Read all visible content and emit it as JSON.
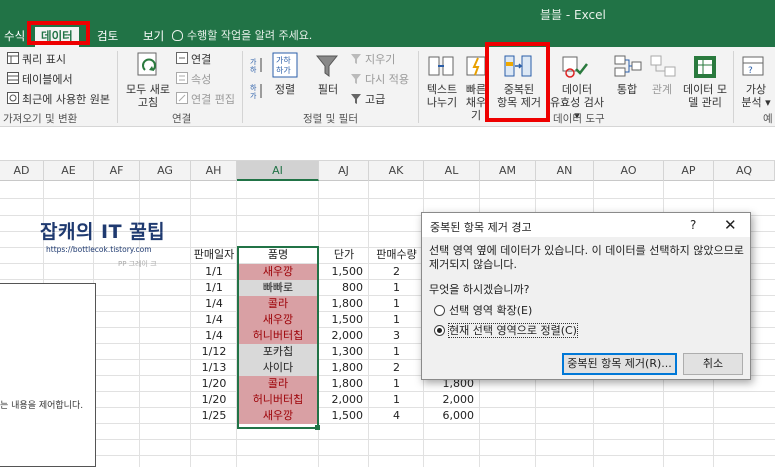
{
  "window": {
    "title": "블블 - Excel"
  },
  "tabs": [
    {
      "label": "수식"
    },
    {
      "label": "데이터"
    },
    {
      "label": "검토"
    },
    {
      "label": "보기"
    }
  ],
  "tell_me": "수행할 작업을 알려 주세요.",
  "ribbon": {
    "get_transform": {
      "items": [
        "쿼리 표시",
        "테이블에서",
        "최근에 사용한 원본"
      ],
      "group_label": "가져오기 및 변환"
    },
    "connections": {
      "refresh_all_line1": "모두 새로",
      "refresh_all_line2": "고침",
      "items": [
        "연결",
        "속성",
        "연결 편집"
      ],
      "group_label": "연결"
    },
    "sort_filter": {
      "sort": "정렬",
      "filter": "필터",
      "clear": "지우기",
      "reapply": "다시 적용",
      "advanced": "고급",
      "group_label": "정렬 및 필터"
    },
    "data_tools": {
      "text_to_columns_line1": "텍스트",
      "text_to_columns_line2": "나누기",
      "flash_fill_line1": "빠른",
      "flash_fill_line2": "채우기",
      "remove_dup_line1": "중복된",
      "remove_dup_line2": "항목 제거",
      "validation_line1": "데이터",
      "validation_line2": "유효성 검사",
      "consolidate": "통합",
      "relationships": "관계",
      "data_model_line1": "데이터 모",
      "data_model_line2": "델 관리",
      "group_label": "데이터 도구"
    },
    "forecast": {
      "whatif_line1": "가상",
      "whatif_line2": "분석",
      "group_label": "예"
    }
  },
  "columns": [
    "AD",
    "AE",
    "AF",
    "AG",
    "AH",
    "AI",
    "AJ",
    "AK",
    "AL",
    "AM",
    "AN",
    "AO",
    "AP",
    "AQ"
  ],
  "blog": {
    "title": "잡캐의 IT 꿀팁",
    "url": "https://bottlecok.tistory.com",
    "tag": "PP 그레이 크"
  },
  "side_text": "는 내용을 제어합니다.",
  "table": {
    "headers": [
      "판매일자",
      "품명",
      "단가",
      "판매수량"
    ],
    "rows": [
      {
        "date": "1/1",
        "item": "새우깡",
        "price": "1,500",
        "qty": "2",
        "total": "",
        "hl": "pink"
      },
      {
        "date": "1/1",
        "item": "빠빠로",
        "price": "800",
        "qty": "1",
        "total": "",
        "hl": "gray"
      },
      {
        "date": "1/4",
        "item": "콜라",
        "price": "1,800",
        "qty": "1",
        "total": "",
        "hl": "pink"
      },
      {
        "date": "1/4",
        "item": "새우깡",
        "price": "1,500",
        "qty": "1",
        "total": "",
        "hl": "pink"
      },
      {
        "date": "1/4",
        "item": "허니버터칩",
        "price": "2,000",
        "qty": "3",
        "total": "",
        "hl": "pink"
      },
      {
        "date": "1/12",
        "item": "포카칩",
        "price": "1,300",
        "qty": "1",
        "total": "",
        "hl": "gray"
      },
      {
        "date": "1/13",
        "item": "사이다",
        "price": "1,800",
        "qty": "2",
        "total": "",
        "hl": "gray"
      },
      {
        "date": "1/20",
        "item": "콜라",
        "price": "1,800",
        "qty": "1",
        "total": "1,800",
        "hl": "pink"
      },
      {
        "date": "1/20",
        "item": "허니버터칩",
        "price": "2,000",
        "qty": "1",
        "total": "2,000",
        "hl": "pink"
      },
      {
        "date": "1/25",
        "item": "새우깡",
        "price": "1,500",
        "qty": "4",
        "total": "6,000",
        "hl": "pink"
      }
    ]
  },
  "dialog": {
    "title": "중복된 항목 제거 경고",
    "help": "?",
    "close": "✕",
    "message": "선택 영역 옆에 데이터가 있습니다. 이 데이터를 선택하지 않았으므로 제거되지 않습니다.",
    "question": "무엇을 하시겠습니까?",
    "option1": "선택 영역 확장(E)",
    "option2": "현재 선택 영역으로 정렬(C)",
    "selected_option": 2,
    "ok_button": "중복된 항목 제거(R)...",
    "cancel_button": "취소"
  },
  "colors": {
    "excel_green": "#217346",
    "highlight_red": "#e00000",
    "duplicate_fill": "#d9a0a4",
    "duplicate_text": "#9c0006"
  }
}
